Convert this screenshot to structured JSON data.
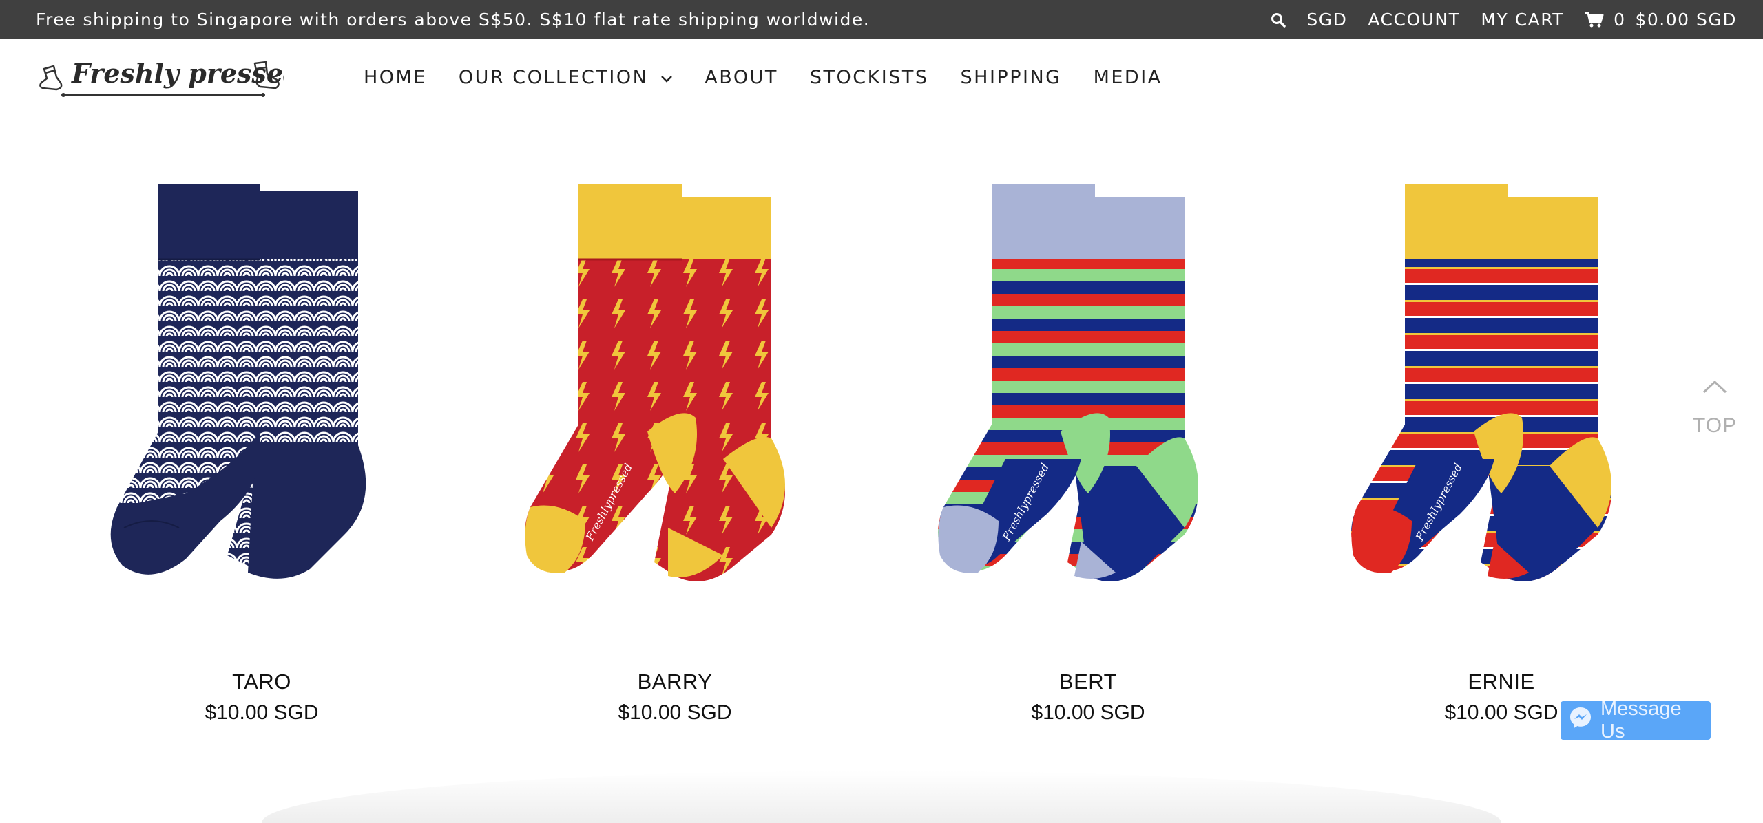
{
  "announcement": {
    "text": "Free shipping to Singapore with orders above S$50. S$10 flat rate shipping worldwide."
  },
  "utility_nav": {
    "search_icon": "search-icon",
    "currency": "SGD",
    "account": "ACCOUNT",
    "my_cart": "MY CART",
    "cart_icon": "cart-icon",
    "cart_count": "0",
    "cart_total": "$0.00 SGD"
  },
  "logo": {
    "text": "Freshly pressed"
  },
  "main_nav": {
    "items": [
      {
        "label": "HOME"
      },
      {
        "label": "OUR COLLECTION",
        "has_dropdown": true
      },
      {
        "label": "ABOUT"
      },
      {
        "label": "STOCKISTS"
      },
      {
        "label": "SHIPPING"
      },
      {
        "label": "MEDIA"
      }
    ]
  },
  "products": [
    {
      "name": "TARO",
      "price": "$10.00 SGD",
      "colors": {
        "cuff": "#1e2658",
        "body": "#1e2658",
        "pattern": "wave",
        "heel": "#1e2658",
        "toe": "#1e2658"
      }
    },
    {
      "name": "BARRY",
      "price": "$10.00 SGD",
      "colors": {
        "cuff": "#f0c63c",
        "body": "#c8202a",
        "pattern": "bolt",
        "heel": "#f0c63c",
        "toe": "#f0c63c"
      }
    },
    {
      "name": "BERT",
      "price": "$10.00 SGD",
      "colors": {
        "cuff": "#a9b3d6",
        "body": "#142a86",
        "pattern": "stripes-green",
        "heel": "#8fd98a",
        "toe": "#a9b3d6"
      }
    },
    {
      "name": "ERNIE",
      "price": "$10.00 SGD",
      "colors": {
        "cuff": "#f0c63c",
        "body": "#142a86",
        "pattern": "stripes-red",
        "heel": "#f0c63c",
        "toe": "#e02822"
      }
    }
  ],
  "back_to_top": {
    "label": "TOP",
    "icon": "chevron-up-icon"
  },
  "messenger": {
    "label": "Message Us",
    "icon": "messenger-icon"
  },
  "colors": {
    "topbar_bg": "#404040",
    "messenger_bg": "#5aa6f8"
  }
}
